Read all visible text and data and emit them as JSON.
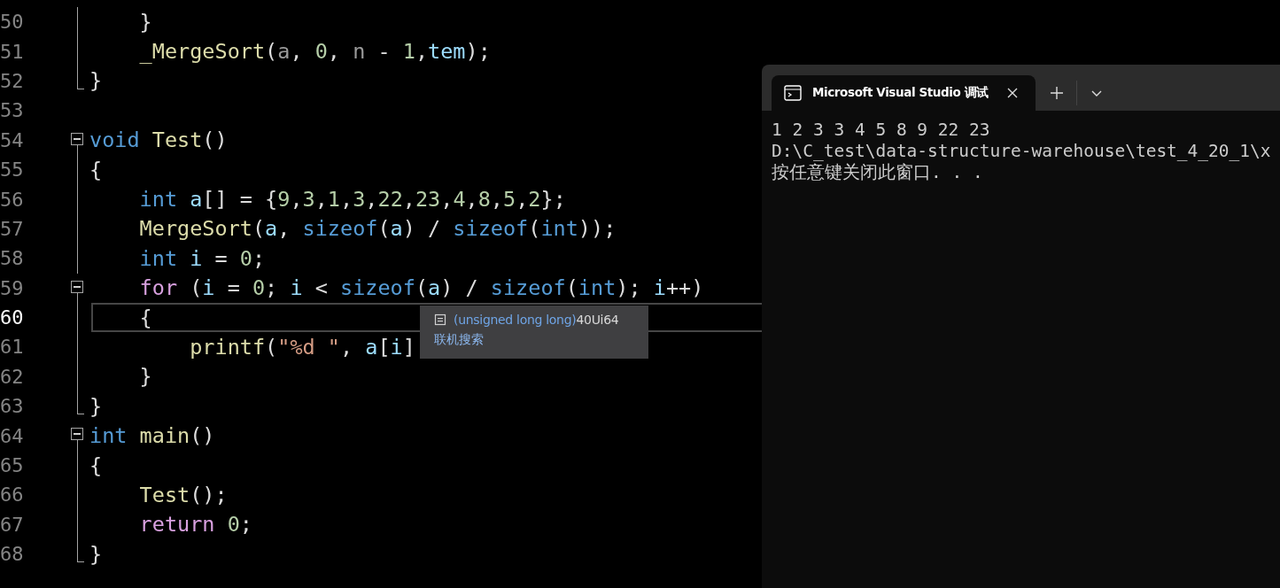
{
  "editor": {
    "lines": [
      {
        "number": "50",
        "current": false,
        "collapsible": false,
        "block_end": false,
        "tokens": [
          {
            "kind": "plain",
            "text": "    }"
          }
        ]
      },
      {
        "number": "51",
        "current": false,
        "collapsible": false,
        "block_end": false,
        "tokens": [
          {
            "kind": "function",
            "text": "    _MergeSort"
          },
          {
            "kind": "plain",
            "text": "("
          },
          {
            "kind": "param",
            "text": "a"
          },
          {
            "kind": "plain",
            "text": ", "
          },
          {
            "kind": "number",
            "text": "0"
          },
          {
            "kind": "plain",
            "text": ", "
          },
          {
            "kind": "param",
            "text": "n"
          },
          {
            "kind": "plain",
            "text": " - "
          },
          {
            "kind": "number",
            "text": "1"
          },
          {
            "kind": "plain",
            "text": ","
          },
          {
            "kind": "local",
            "text": "tem"
          },
          {
            "kind": "plain",
            "text": ");"
          }
        ]
      },
      {
        "number": "52",
        "current": false,
        "collapsible": false,
        "block_end": true,
        "tokens": [
          {
            "kind": "plain",
            "text": "}"
          }
        ]
      },
      {
        "number": "53",
        "current": false
      },
      {
        "number": "54",
        "current": false,
        "collapsible": true,
        "block_end": false,
        "tokens": [
          {
            "kind": "keyword",
            "text": "void"
          },
          {
            "kind": "function",
            "text": " Test"
          },
          {
            "kind": "plain",
            "text": "()"
          }
        ]
      },
      {
        "number": "55",
        "current": false,
        "collapsible": false,
        "block_end": false,
        "tokens": [
          {
            "kind": "plain",
            "text": "{"
          }
        ]
      },
      {
        "number": "56",
        "current": false,
        "collapsible": false,
        "block_end": false,
        "tokens": [
          {
            "kind": "keyword",
            "text": "    int"
          },
          {
            "kind": "local",
            "text": " a"
          },
          {
            "kind": "plain",
            "text": "[] = {"
          },
          {
            "kind": "number",
            "text": "9"
          },
          {
            "kind": "plain",
            "text": ","
          },
          {
            "kind": "number",
            "text": "3"
          },
          {
            "kind": "plain",
            "text": ","
          },
          {
            "kind": "number",
            "text": "1"
          },
          {
            "kind": "plain",
            "text": ","
          },
          {
            "kind": "number",
            "text": "3"
          },
          {
            "kind": "plain",
            "text": ","
          },
          {
            "kind": "number",
            "text": "22"
          },
          {
            "kind": "plain",
            "text": ","
          },
          {
            "kind": "number",
            "text": "23"
          },
          {
            "kind": "plain",
            "text": ","
          },
          {
            "kind": "number",
            "text": "4"
          },
          {
            "kind": "plain",
            "text": ","
          },
          {
            "kind": "number",
            "text": "8"
          },
          {
            "kind": "plain",
            "text": ","
          },
          {
            "kind": "number",
            "text": "5"
          },
          {
            "kind": "plain",
            "text": ","
          },
          {
            "kind": "number",
            "text": "2"
          },
          {
            "kind": "plain",
            "text": "};"
          }
        ]
      },
      {
        "number": "57",
        "current": false,
        "collapsible": false,
        "block_end": false,
        "tokens": [
          {
            "kind": "function",
            "text": "    MergeSort"
          },
          {
            "kind": "plain",
            "text": "("
          },
          {
            "kind": "local",
            "text": "a"
          },
          {
            "kind": "plain",
            "text": ", "
          },
          {
            "kind": "keyword",
            "text": "sizeof"
          },
          {
            "kind": "plain",
            "text": "("
          },
          {
            "kind": "local",
            "text": "a"
          },
          {
            "kind": "plain",
            "text": ") / "
          },
          {
            "kind": "keyword",
            "text": "sizeof"
          },
          {
            "kind": "plain",
            "text": "("
          },
          {
            "kind": "keyword",
            "text": "int"
          },
          {
            "kind": "plain",
            "text": "));"
          }
        ]
      },
      {
        "number": "58",
        "current": false,
        "collapsible": false,
        "block_end": false,
        "tokens": [
          {
            "kind": "keyword",
            "text": "    int"
          },
          {
            "kind": "local",
            "text": " i"
          },
          {
            "kind": "plain",
            "text": " = "
          },
          {
            "kind": "number",
            "text": "0"
          },
          {
            "kind": "plain",
            "text": ";"
          }
        ]
      },
      {
        "number": "59",
        "current": false,
        "collapsible": true,
        "block_end": false,
        "tokens": [
          {
            "kind": "control",
            "text": "    for"
          },
          {
            "kind": "plain",
            "text": " ("
          },
          {
            "kind": "local",
            "text": "i"
          },
          {
            "kind": "plain",
            "text": " = "
          },
          {
            "kind": "number",
            "text": "0"
          },
          {
            "kind": "plain",
            "text": "; "
          },
          {
            "kind": "local",
            "text": "i"
          },
          {
            "kind": "plain",
            "text": " < "
          },
          {
            "kind": "keyword",
            "text": "sizeof"
          },
          {
            "kind": "plain",
            "text": "("
          },
          {
            "kind": "local",
            "text": "a"
          },
          {
            "kind": "plain",
            "text": ") / "
          },
          {
            "kind": "keyword",
            "text": "sizeof"
          },
          {
            "kind": "plain",
            "text": "("
          },
          {
            "kind": "keyword",
            "text": "int"
          },
          {
            "kind": "plain",
            "text": "); "
          },
          {
            "kind": "local",
            "text": "i"
          },
          {
            "kind": "plain",
            "text": "++)"
          }
        ]
      },
      {
        "number": "60",
        "current": true,
        "collapsible": false,
        "block_end": false,
        "tokens": [
          {
            "kind": "plain",
            "text": "    {"
          }
        ]
      },
      {
        "number": "61",
        "current": false,
        "collapsible": false,
        "block_end": false,
        "tokens": [
          {
            "kind": "function",
            "text": "        printf"
          },
          {
            "kind": "plain",
            "text": "("
          },
          {
            "kind": "string",
            "text": "\"%d \""
          },
          {
            "kind": "plain",
            "text": ", "
          },
          {
            "kind": "local",
            "text": "a"
          },
          {
            "kind": "plain",
            "text": "["
          },
          {
            "kind": "local",
            "text": "i"
          },
          {
            "kind": "plain",
            "text": "]"
          }
        ]
      },
      {
        "number": "62",
        "current": false,
        "collapsible": false,
        "block_end": false,
        "tokens": [
          {
            "kind": "plain",
            "text": "    }"
          }
        ]
      },
      {
        "number": "63",
        "current": false,
        "collapsible": false,
        "block_end": true,
        "tokens": [
          {
            "kind": "plain",
            "text": "}"
          }
        ]
      },
      {
        "number": "64",
        "current": false,
        "collapsible": true,
        "block_end": false,
        "tokens": [
          {
            "kind": "keyword",
            "text": "int"
          },
          {
            "kind": "function",
            "text": " main"
          },
          {
            "kind": "plain",
            "text": "()"
          }
        ]
      },
      {
        "number": "65",
        "current": false,
        "collapsible": false,
        "block_end": false,
        "tokens": [
          {
            "kind": "plain",
            "text": "{"
          }
        ]
      },
      {
        "number": "66",
        "current": false,
        "collapsible": false,
        "block_end": false,
        "tokens": [
          {
            "kind": "function",
            "text": "    Test"
          },
          {
            "kind": "plain",
            "text": "();"
          }
        ]
      },
      {
        "number": "67",
        "current": false,
        "collapsible": false,
        "block_end": false,
        "tokens": [
          {
            "kind": "control",
            "text": "    return"
          },
          {
            "kind": "number",
            "text": " 0"
          },
          {
            "kind": "plain",
            "text": ";"
          }
        ]
      },
      {
        "number": "68",
        "current": false,
        "collapsible": false,
        "block_end": true,
        "tokens": [
          {
            "kind": "plain",
            "text": "}"
          }
        ]
      }
    ]
  },
  "tooltip": {
    "type_text": "(unsigned long long)",
    "value": "40Ui64",
    "link": "联机搜索"
  },
  "terminal": {
    "tab_title": "Microsoft Visual Studio 调试",
    "output": [
      "1 2 3 3 4 5 8 9 22 23",
      "D:\\C_test\\data-structure-warehouse\\test_4_20_1\\x",
      "按任意键关闭此窗口. . ."
    ]
  }
}
